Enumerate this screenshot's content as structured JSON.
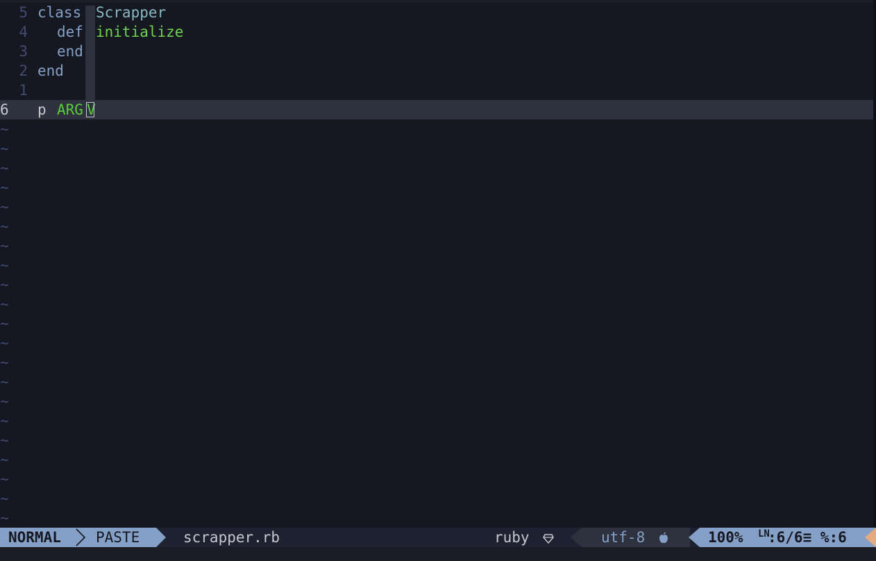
{
  "editor": {
    "lines": [
      {
        "num": "5",
        "tokens": [
          {
            "text": "class",
            "kind": "kw"
          },
          {
            "text": "Scrapper",
            "kind": "cls"
          }
        ]
      },
      {
        "num": "4",
        "tokens": [
          {
            "text": "def",
            "kind": "kw"
          },
          {
            "text": "initialize",
            "kind": "fn"
          }
        ]
      },
      {
        "num": "3",
        "tokens": [
          {
            "text": "end",
            "kind": "kw"
          }
        ]
      },
      {
        "num": "2",
        "tokens": [
          {
            "text": "end",
            "kind": "kw"
          }
        ]
      },
      {
        "num": "1",
        "tokens": []
      },
      {
        "num": "6",
        "current": true,
        "tokens": [
          {
            "text": "p",
            "kind": "plain"
          },
          {
            "text": "ARG",
            "kind": "const"
          },
          {
            "text": "V",
            "kind": "const"
          }
        ]
      }
    ],
    "tilde": "~",
    "tilde_count": 21
  },
  "statusline": {
    "mode": "NORMAL",
    "paste": "PASTE",
    "filename": "scrapper.rb",
    "filetype": "ruby",
    "filetype_icon": "ruby-icon",
    "encoding": "utf-8",
    "os_icon": "apple-icon",
    "percent": "100%",
    "line_symbol": "LN",
    "position": ":6/6≡ %:6"
  },
  "colors": {
    "background": "#161821",
    "cursorline": "#2e313e",
    "accent": "#84a0c6",
    "keyword": "#84a0c6",
    "class": "#89b8c2",
    "function": "#6fd34c",
    "constant": "#5bcd3b",
    "tail": "#e4aa80"
  }
}
